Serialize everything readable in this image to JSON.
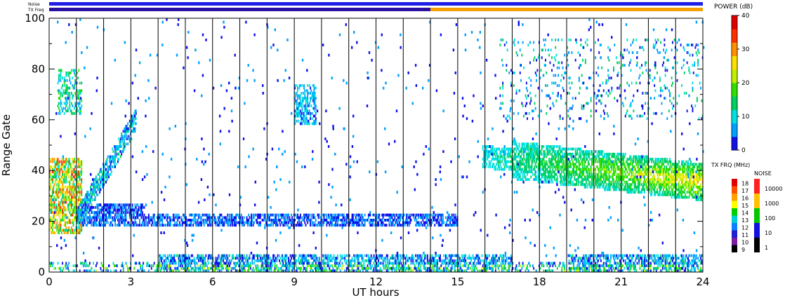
{
  "chart_data": {
    "type": "heatmap",
    "xlabel": "UT hours",
    "ylabel": "Range Gate",
    "xlim": [
      0,
      24
    ],
    "ylim": [
      0,
      100
    ],
    "x_ticks": [
      "0",
      "3",
      "6",
      "9",
      "12",
      "15",
      "18",
      "21",
      "24"
    ],
    "y_ticks": [
      "0",
      "20",
      "40",
      "60",
      "80",
      "100"
    ],
    "scan_boundaries_hours": [
      1,
      2,
      3,
      4,
      5,
      6,
      7,
      8,
      9,
      10,
      11,
      12,
      13,
      14,
      15,
      16,
      17,
      18,
      19,
      20,
      21,
      22,
      23
    ],
    "status_bars": {
      "noise_label": "Noise",
      "txfreq_label": "TX Freq",
      "noise_color": "#1e1ee6",
      "txfreq_segments": [
        {
          "start": 0,
          "end": 14,
          "color": "#2a10a0"
        },
        {
          "start": 14,
          "end": 24,
          "color": "#f5a000"
        }
      ]
    },
    "power_colorbar": {
      "title": "POWER (dB)",
      "ticks": [
        "0",
        "10",
        "20",
        "30",
        "40"
      ],
      "range": [
        0,
        40
      ],
      "colors": [
        "#1010e8",
        "#00a0ff",
        "#00e0e0",
        "#00d060",
        "#30e000",
        "#c0f000",
        "#ffe000",
        "#ff9000",
        "#ff3000",
        "#e00000"
      ]
    },
    "txfreq_colorbar": {
      "title": "TX FRQ (MHz)",
      "levels": [
        "9",
        "10",
        "11",
        "12",
        "13",
        "14",
        "15",
        "16",
        "17",
        "18"
      ],
      "colors": [
        "#000000",
        "#7a1fa0",
        "#2020d0",
        "#1080ff",
        "#00d0d0",
        "#00d000",
        "#ffff00",
        "#ffa000",
        "#ff5000",
        "#e00000"
      ]
    },
    "noise_colorbar": {
      "title": "NOISE",
      "levels": [
        "1",
        "10",
        "100",
        "1000",
        "10000"
      ],
      "colors": [
        "#000000",
        "#1010e0",
        "#00c800",
        "#ffc000",
        "#ff2020"
      ]
    },
    "echo_regions": [
      {
        "name": "early near-range echoes",
        "x_range": [
          0.0,
          1.2
        ],
        "gate_range": [
          15,
          45
        ],
        "power_db": [
          10,
          35
        ]
      },
      {
        "name": "early far-range patch",
        "x_range": [
          0.3,
          1.2
        ],
        "gate_range": [
          62,
          80
        ],
        "power_db": [
          5,
          18
        ]
      },
      {
        "name": "rising arc",
        "x_range": [
          1.0,
          3.2
        ],
        "gate_range": [
          20,
          60
        ],
        "power_db": [
          2,
          14
        ]
      },
      {
        "name": "gate-20 band",
        "x_range": [
          1.2,
          15.0
        ],
        "gate_range": [
          17,
          27
        ],
        "power_db": [
          0,
          8
        ]
      },
      {
        "name": "patch near 9.5 h",
        "x_range": [
          9.0,
          9.8
        ],
        "gate_range": [
          58,
          74
        ],
        "power_db": [
          2,
          12
        ]
      },
      {
        "name": "near-range ground echoes",
        "x_range": [
          0.0,
          24.0
        ],
        "gate_range": [
          0,
          8
        ],
        "power_db": [
          0,
          22
        ]
      },
      {
        "name": "afternoon band",
        "x_range": [
          15.9,
          24.0
        ],
        "gate_range": [
          25,
          52
        ],
        "power_db": [
          5,
          32
        ]
      },
      {
        "name": "afternoon far-range scatter",
        "x_range": [
          16.5,
          24.0
        ],
        "gate_range": [
          60,
          92
        ],
        "power_db": [
          0,
          15
        ]
      }
    ]
  }
}
